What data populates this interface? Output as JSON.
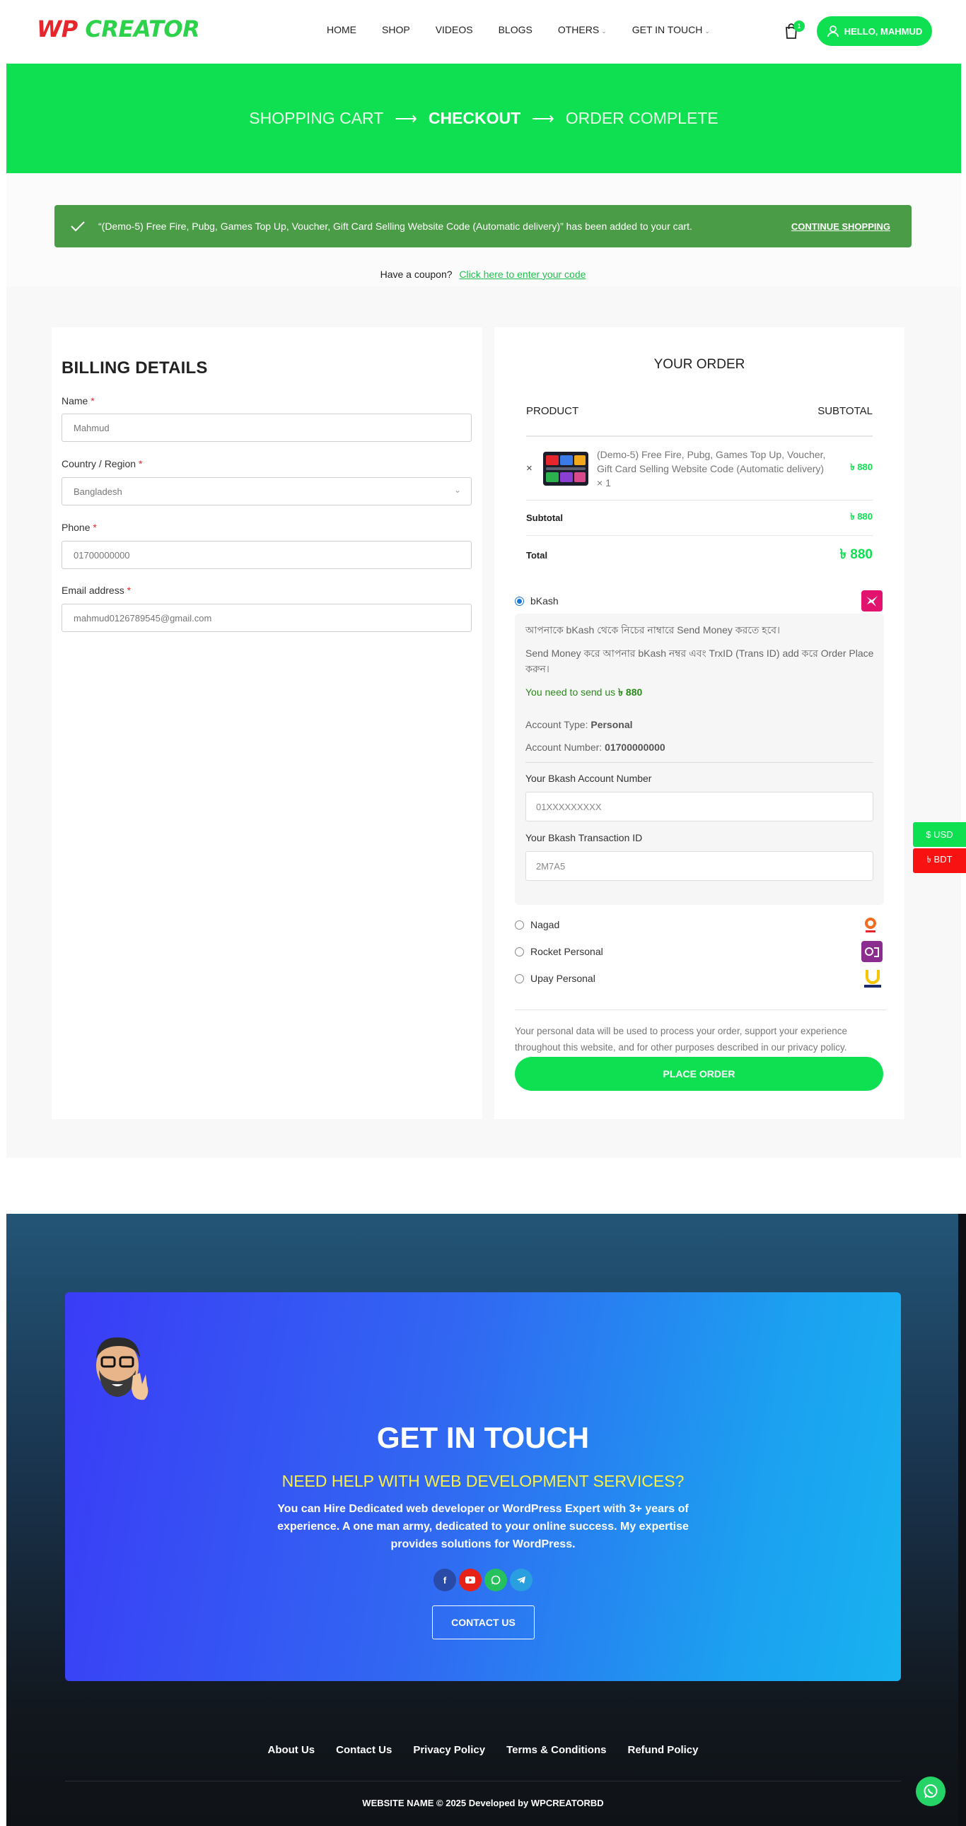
{
  "header": {
    "logo_wp": "WP",
    "logo_creator": "CREATOR",
    "nav": [
      {
        "label": "HOME",
        "has_chevron": false
      },
      {
        "label": "SHOP",
        "has_chevron": false
      },
      {
        "label": "VIDEOS",
        "has_chevron": false
      },
      {
        "label": "BLOGS",
        "has_chevron": false
      },
      {
        "label": "OTHERS",
        "has_chevron": true
      },
      {
        "label": "GET IN TOUCH",
        "has_chevron": true
      }
    ],
    "cart_count": "1",
    "hello_label": "HELLO, MAHMUD"
  },
  "steps": {
    "step1": "SHOPPING CART",
    "step2": "CHECKOUT",
    "step3": "ORDER COMPLETE"
  },
  "notice": {
    "message": "“(Demo-5) Free Fire, Pubg, Games Top Up, Voucher, Gift Card Selling Website Code (Automatic delivery)” has been added to your cart.",
    "continue_label": "CONTINUE SHOPPING"
  },
  "coupon": {
    "prompt": "Have a coupon?",
    "link": "Click here to enter your code"
  },
  "billing": {
    "title": "BILLING DETAILS",
    "fields": {
      "name": {
        "label": "Name",
        "value": "Mahmud"
      },
      "country": {
        "label": "Country / Region",
        "value": "Bangladesh"
      },
      "phone": {
        "label": "Phone",
        "value": "01700000000"
      },
      "email": {
        "label": "Email address",
        "value": "mahmud0126789545@gmail.com"
      }
    },
    "required_mark": "*"
  },
  "order": {
    "title": "YOUR ORDER",
    "col_product": "PRODUCT",
    "col_subtotal": "SUBTOTAL",
    "remove_icon": "×",
    "item_name": "(Demo-5) Free Fire, Pubg, Games Top Up, Voucher, Gift Card Selling Website Code (Automatic delivery)",
    "item_qty": "× 1",
    "item_price": "৳ 880",
    "subtotal_label": "Subtotal",
    "subtotal_value": "৳ 880",
    "total_label": "Total",
    "total_value": "৳ 880"
  },
  "payment": {
    "bkash_label": "bKash",
    "bkash_line1": "আপনাকে bKash থেকে নিচের নাম্বারে Send Money করতে হবে।",
    "bkash_line2": "Send Money করে আপনার bKash নম্বর এবং TrxID (Trans ID) add করে Order Place করুন।",
    "need_send_prefix": "You need to send us",
    "need_send_amount": "৳ 880",
    "account_type_label": "Account Type:",
    "account_type_value": "Personal",
    "account_number_label": "Account Number:",
    "account_number_value": "01700000000",
    "acc_field_label": "Your Bkash Account Number",
    "acc_field_placeholder": "01XXXXXXXXX",
    "trx_field_label": "Your Bkash Transaction ID",
    "trx_field_placeholder": "2M7A5",
    "nagad_label": "Nagad",
    "rocket_label": "Rocket Personal",
    "upay_label": "Upay Personal",
    "privacy_text": "Your personal data will be used to process your order, support your experience throughout this website, and for other purposes described in our privacy policy.",
    "place_order": "PLACE ORDER"
  },
  "currency": {
    "usd": "$ USD",
    "bdt": "৳ BDT"
  },
  "cta": {
    "title": "GET IN TOUCH",
    "subtitle": "NEED HELP WITH WEB DEVELOPMENT SERVICES?",
    "description": "You can Hire Dedicated web developer or WordPress Expert with 3+ years of experience. A one man army, dedicated to your online success. My expertise provides solutions for WordPress.",
    "contact_button": "CONTACT US",
    "socials": [
      "facebook-icon",
      "youtube-icon",
      "whatsapp-icon",
      "telegram-icon"
    ]
  },
  "footer": {
    "links": [
      "About Us",
      "Contact Us",
      "Privacy Policy",
      "Terms & Conditions",
      "Refund Policy"
    ],
    "copyright": "WEBSITE NAME © 2025 Developed by WPCREATORBD"
  },
  "colors": {
    "brand_green": "#0ee052",
    "notice_green": "#4a9c46",
    "bdt_red": "#f81212"
  }
}
